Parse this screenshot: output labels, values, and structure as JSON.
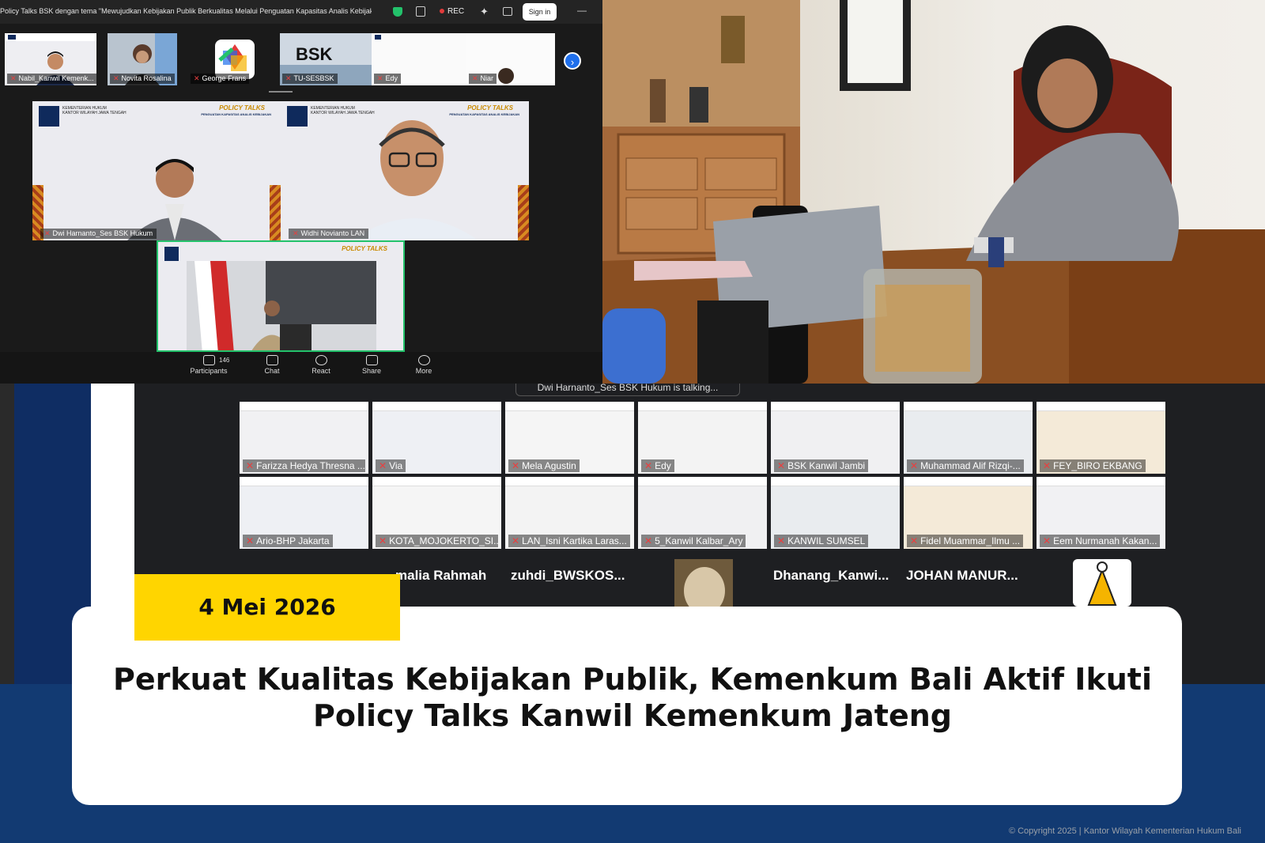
{
  "zoom_top": {
    "meeting_title": "Policy Talks BSK dengan tema \"Mewujudkan Kebijakan Publik Berkualitas Melalui Penguatan Kapasitas Analis Kebijakan Provi",
    "rec_label": "REC",
    "sign_in_label": "Sign in",
    "strip_participants": [
      "Nabil_Kanwil Kemenk...",
      "Novita Rosalina",
      "George Frans",
      "TU-SESBSK",
      "Edy",
      "Niar"
    ],
    "main_participants": [
      "Dwi Harnanto_Ses BSK Hukum",
      "Widhi Novianto LAN"
    ],
    "tile_header": "KEMENTERIAN HUKUM",
    "tile_header_sub": "KANTOR WILAYAH JAWA TENGAH",
    "policy_talks": "POLICY TALKS",
    "policy_sub": "PENGUATAN KAPASITAS ANALIS KEBIJAKAN",
    "participants_count": "146",
    "toolbar": {
      "participants": "Participants",
      "chat": "Chat",
      "react": "React",
      "share": "Share",
      "more": "More"
    }
  },
  "zoom_bottom": {
    "talking_banner": "Dwi Harnanto_Ses BSK Hukum is talking...",
    "row1": [
      "Farizza Hedya Thresna ...",
      "Via",
      "Mela Agustin",
      "Edy",
      "BSK Kanwil Jambi",
      "Muhammad Alif Rizqi-...",
      "FEY_BIRO EKBANG"
    ],
    "row2": [
      "Ario-BHP Jakarta",
      "KOTA_MOJOKERTO_SI...",
      "LAN_Isni Kartika Laras...",
      "5_Kanwil Kalbar_Ary",
      "KANWIL SUMSEL",
      "Fidel Muammar_Ilmu ...",
      "Eem Nurmanah Kakan..."
    ],
    "name_row": [
      "malia Rahmah",
      "zuhdi_BWSKOS...",
      "Dhanang_Kanwi...",
      "JOHAN  MANUR..."
    ]
  },
  "article": {
    "date": "4 Mei 2026",
    "headline_line1": "Perkuat Kualitas Kebijakan Publik, Kemenkum Bali Aktif Ikuti",
    "headline_line2": "Policy Talks Kanwil Kemenkum Jateng",
    "copyright": "© Copyright 2025 | Kantor Wilayah Kementerian Hukum Bali"
  },
  "colors": {
    "accent_yellow": "#ffd500",
    "navy": "#123a72",
    "zoom_blue": "#1f6feb"
  }
}
